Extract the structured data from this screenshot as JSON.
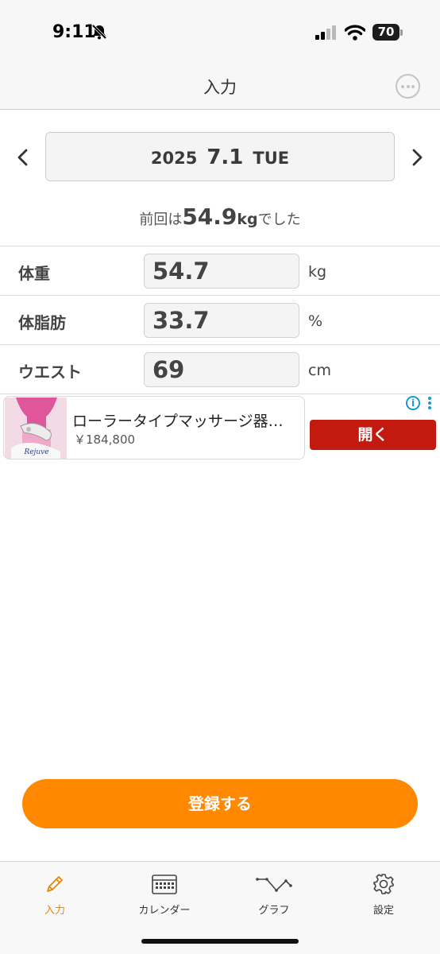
{
  "status_bar": {
    "time": "9:11",
    "battery": "70"
  },
  "nav": {
    "title": "入力"
  },
  "date": {
    "year": "2025",
    "month_day": "7.1",
    "weekday": "TUE"
  },
  "previous": {
    "prefix": "前回は",
    "value": "54.9",
    "unit": "kg",
    "suffix": "でした"
  },
  "rows": [
    {
      "label": "体重",
      "value": "54.7",
      "unit": "kg"
    },
    {
      "label": "体脂肪",
      "value": "33.7",
      "unit": "%"
    },
    {
      "label": "ウエスト",
      "value": "69",
      "unit": "cm"
    }
  ],
  "ad": {
    "title": "ローラータイプマッサージ器…",
    "price": "￥184,800",
    "open_label": "開く",
    "image_brand": "Rejuve",
    "choices_icon": "i"
  },
  "register_label": "登録する",
  "tabs": [
    {
      "label": "入力",
      "icon": "pencil-icon",
      "active": true
    },
    {
      "label": "カレンダー",
      "icon": "calendar-icon",
      "active": false
    },
    {
      "label": "グラフ",
      "icon": "graph-icon",
      "active": false
    },
    {
      "label": "設定",
      "icon": "gear-icon",
      "active": false
    }
  ],
  "colors": {
    "accent": "#ff8800",
    "tab_active": "#f08400",
    "ad_button": "#c21a0e",
    "adchoices": "#1a98d5"
  }
}
